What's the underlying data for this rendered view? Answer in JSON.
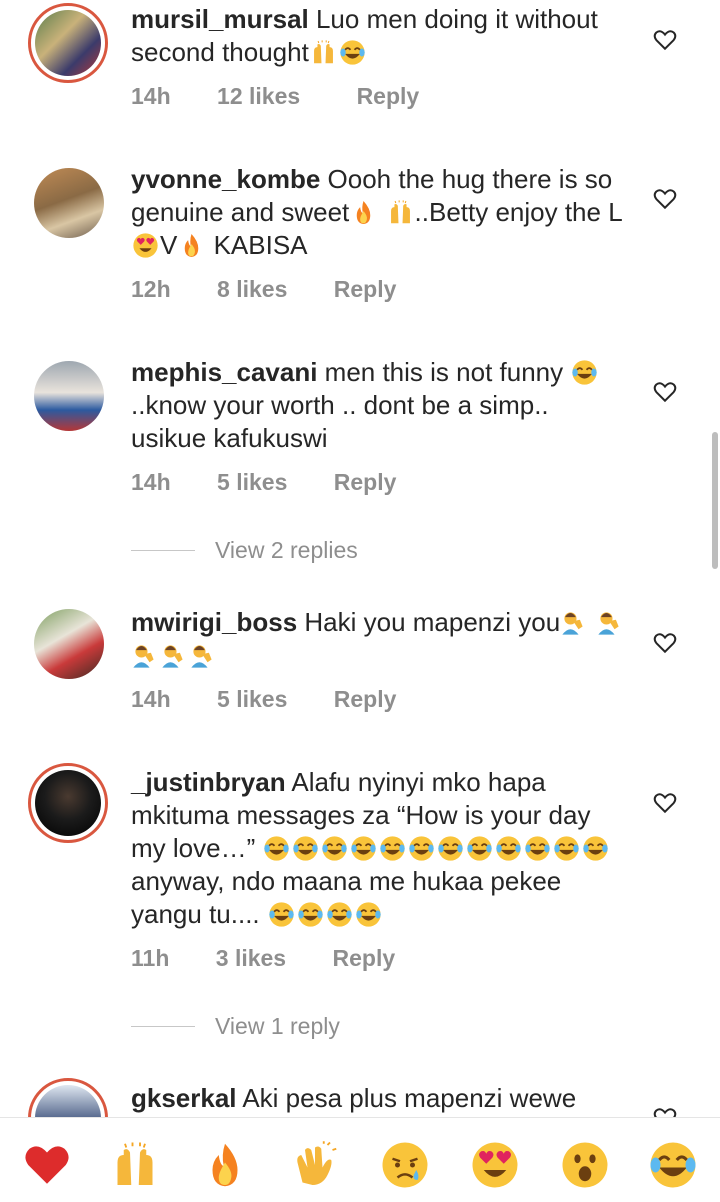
{
  "comments": [
    {
      "username": "mursil_mursal",
      "text": " Luo men doing it without second thought",
      "emoji_suffix": [
        "raising-hands",
        "joy"
      ],
      "time": "14h",
      "likes": "12 likes",
      "reply": "Reply",
      "avatar_story_ring": true
    },
    {
      "username": "yvonne_kombe",
      "text_parts": [
        " Oooh the hug there is so genuine and sweet",
        "..Betty enjoy the L",
        "V",
        " KABISA"
      ],
      "time": "12h",
      "likes": "8 likes",
      "reply": "Reply",
      "avatar_story_ring": false
    },
    {
      "username": "mephis_cavani",
      "text_parts": [
        " men this is not funny ",
        "..know your worth .. dont be a simp.. usikue kafukuswi"
      ],
      "time": "14h",
      "likes": "5 likes",
      "reply": "Reply",
      "view_replies": "View 2 replies",
      "avatar_story_ring": false
    },
    {
      "username": "mwirigi_boss",
      "text": " Haki you mapenzi you",
      "time": "14h",
      "likes": "5 likes",
      "reply": "Reply",
      "avatar_story_ring": false
    },
    {
      "username": "_justinbryan",
      "text_parts": [
        " Alafu nyinyi mko hapa mkituma messages za “How is your day my love…” ",
        " anyway, ndo maana me hukaa pekee yangu tu.... "
      ],
      "time": "11h",
      "likes": "3 likes",
      "reply": "Reply",
      "view_replies": "View 1 reply",
      "avatar_story_ring": true
    },
    {
      "username": "gkserkal",
      "text": " Aki pesa plus mapenzi wewe",
      "avatar_story_ring": true
    }
  ],
  "reactions": [
    "red-heart",
    "raising-hands",
    "fire",
    "clapping-hands",
    "crying-face",
    "heart-eyes",
    "surprised-face",
    "tears-of-joy"
  ],
  "colors": {
    "text": "#262626",
    "secondary": "#8e8e8e",
    "story_ring": "#d9573f"
  }
}
